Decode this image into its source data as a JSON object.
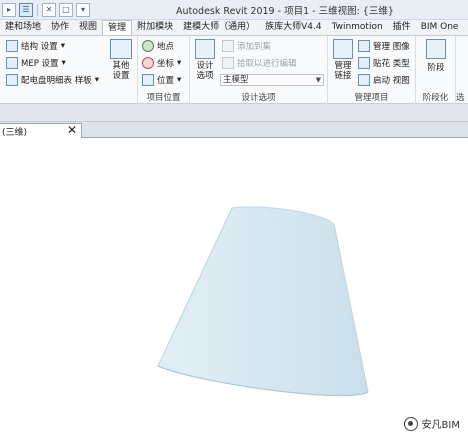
{
  "window": {
    "title": "Autodesk Revit 2019 - 项目1 - 三维视图: {三维}"
  },
  "quick_access": [
    {
      "label": "▸"
    },
    {
      "label": "☰"
    },
    {
      "label": "✕"
    },
    {
      "label": "□"
    },
    {
      "label": "▾"
    }
  ],
  "tabs": [
    {
      "label": "建和场地"
    },
    {
      "label": "协作"
    },
    {
      "label": "视图"
    },
    {
      "label": "管理"
    },
    {
      "label": "附加模块"
    },
    {
      "label": "建模大师（通用）"
    },
    {
      "label": "族库大师V4.4"
    },
    {
      "label": "Twinmotion"
    },
    {
      "label": "插件"
    },
    {
      "label": "BIM One"
    }
  ],
  "ribbon": {
    "settings": {
      "structure": "结构 设置",
      "mep": "MEP 设置",
      "panel_schedules": "配电盘明细表 样板",
      "other": "其他\n设置"
    },
    "location": {
      "place": "地点",
      "coordinates": "坐标",
      "position": "位置",
      "title": "项目位置"
    },
    "design_options": {
      "design": "设计\n选项",
      "add_to_set": "添加到集",
      "pick_to_edit": "拾取以进行编辑",
      "main_model": "主模型",
      "title": "设计选项"
    },
    "manage_project": {
      "manage_links": "管理\n链接",
      "manage_images": "管理 图像",
      "decal_types": "贴花 类型",
      "starting_view": "启动 视图",
      "title": "管理项目"
    },
    "phasing": {
      "phases": "阶段",
      "title": "阶段化"
    },
    "extra": {
      "title": "选"
    }
  },
  "view_tab": {
    "label": "(三维)"
  },
  "watermark": {
    "text": "安凡BIM"
  },
  "colors": {
    "shape_fill": "#dceaf1",
    "shape_edge": "#b9d0dc"
  }
}
